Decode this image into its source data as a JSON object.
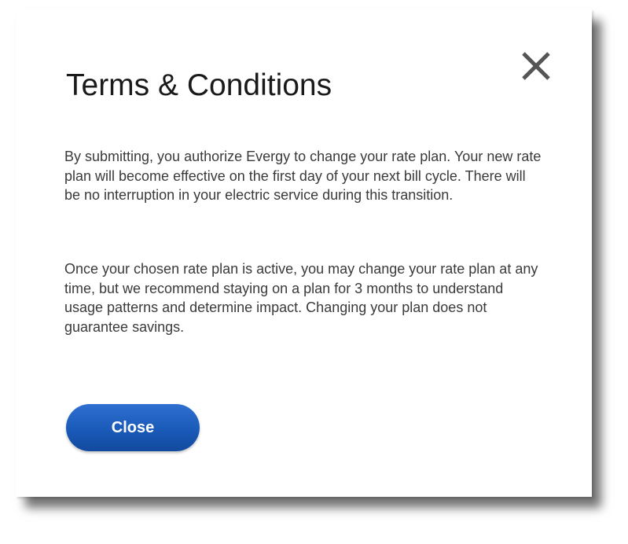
{
  "dialog": {
    "title": "Terms & Conditions",
    "paragraphs": [
      "By submitting, you authorize Evergy to change your rate plan. Your new rate plan will become effective on the first day of your next bill cycle. There will be no interruption in your electric service during this transition.",
      "Once your chosen rate plan is active, you may change your rate plan at any time, but we recommend staying on a plan for 3 months to understand usage patterns and determine impact. Changing your plan does not guarantee savings."
    ],
    "close_button_label": "Close",
    "close_icon": "close-x-icon"
  },
  "colors": {
    "button_blue": "#1a5ab8",
    "title_text": "#1a1a1a",
    "body_text": "#3a3a3a",
    "close_icon": "#555555"
  }
}
